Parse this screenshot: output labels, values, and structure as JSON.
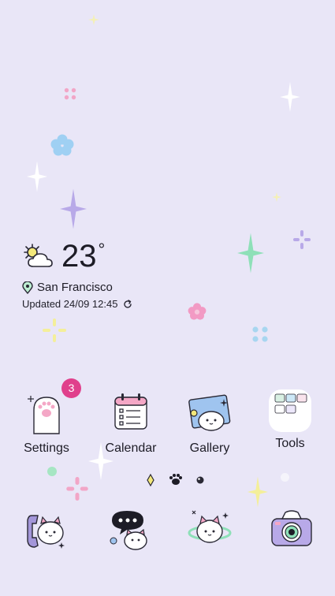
{
  "weather": {
    "temperature": "23",
    "degree_symbol": "°",
    "condition_icon": "partly-sunny-icon",
    "location": "San Francisco",
    "updated_text": "Updated 24/09 12:45"
  },
  "badge_color": "#e0408c",
  "accent_purple": "#a396d9",
  "apps": [
    {
      "label": "Settings",
      "icon": "settings-paw-icon",
      "badge": "3"
    },
    {
      "label": "Calendar",
      "icon": "calendar-icon"
    },
    {
      "label": "Gallery",
      "icon": "gallery-icon"
    },
    {
      "label": "Tools",
      "icon": "tools-folder-icon"
    }
  ],
  "page_indicator": {
    "pages": 3,
    "current": 2
  },
  "dock": [
    {
      "icon": "phone-icon"
    },
    {
      "icon": "messages-icon"
    },
    {
      "icon": "internet-icon"
    },
    {
      "icon": "camera-icon"
    }
  ]
}
